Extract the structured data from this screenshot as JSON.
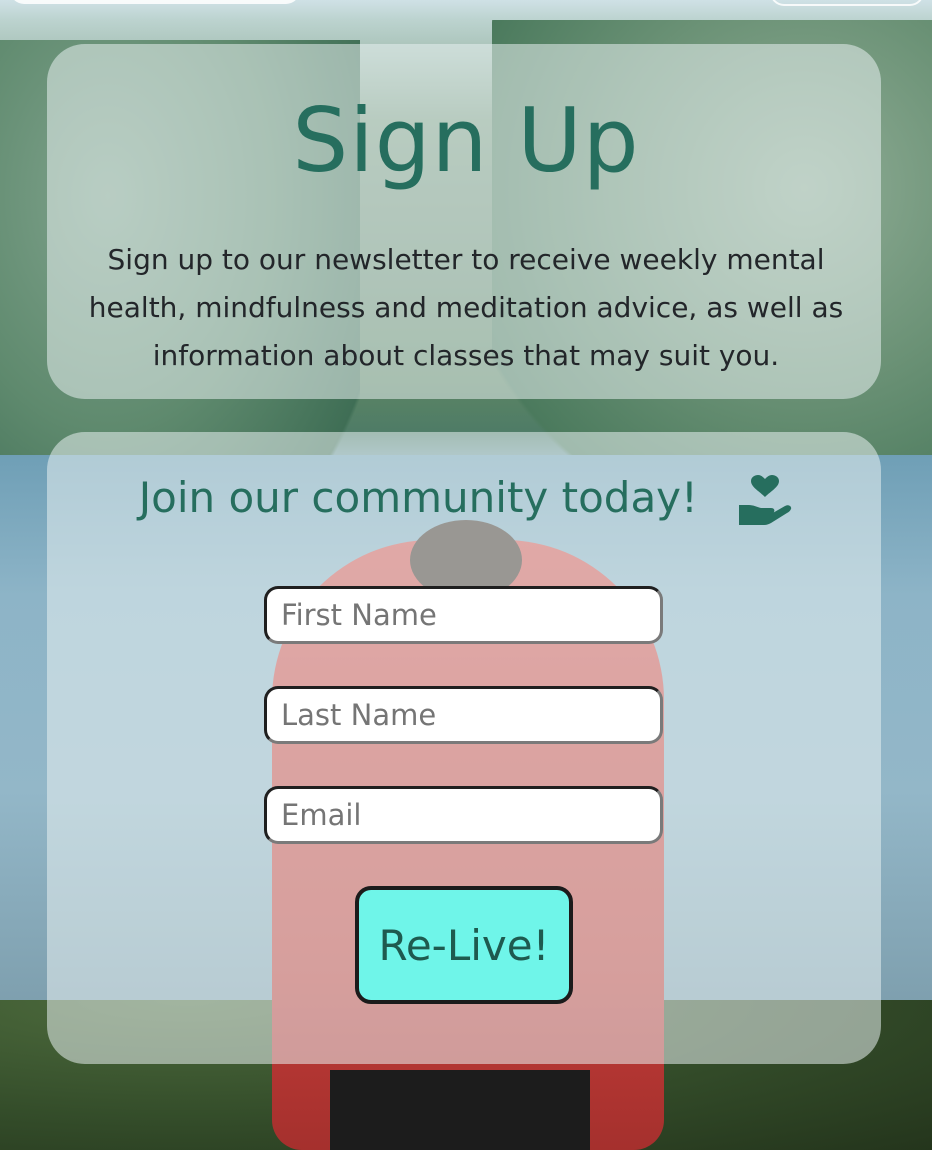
{
  "intro": {
    "title": "Sign Up",
    "text": "Sign up to our newsletter to receive weekly mental health, mindfulness and meditation advice, as well as information about classes that may suit you."
  },
  "form": {
    "heading": "Join our community today!",
    "heading_icon": "hand-holding-heart-icon",
    "first_name_placeholder": "First Name",
    "last_name_placeholder": "Last Name",
    "email_placeholder": "Email",
    "submit_label": "Re-Live!"
  },
  "colors": {
    "accent_text": "#266e5e",
    "button_bg": "#6ff5e9"
  }
}
